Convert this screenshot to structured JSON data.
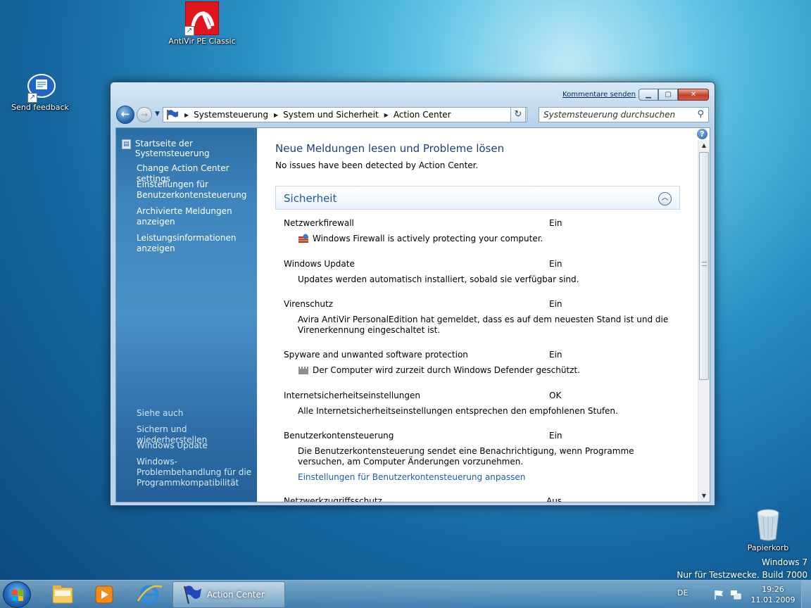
{
  "desktop": {
    "icons": [
      {
        "label": "AntiVir PE Classic",
        "icon": "avira-umbrella-icon"
      },
      {
        "label": "Send feedback",
        "icon": "speech-bubble-icon"
      },
      {
        "label": "Papierkorb",
        "icon": "recycle-bin-icon"
      }
    ],
    "watermark": {
      "line1": "Windows 7",
      "line2": "Nur für Testzwecke. Build 7000"
    }
  },
  "window": {
    "kommentare": "Kommentare senden",
    "controls": {
      "minimize": "minimize-icon",
      "maximize": "maximize-icon",
      "close": "close-icon"
    },
    "breadcrumb": [
      "Systemsteuerung",
      "System und Sicherheit",
      "Action Center"
    ],
    "search_placeholder": "Systemsteuerung durchsuchen",
    "left_pane": {
      "home": "Startseite der Systemsteuerung",
      "links": [
        "Change Action Center settings",
        "Einstellungen für Benutzerkontensteuerung",
        "Archivierte Meldungen anzeigen",
        "Leistungsinformationen anzeigen"
      ],
      "see_also_heading": "Siehe auch",
      "see_also": [
        "Sichern und wiederherstellen",
        "Windows Update",
        "Windows-Problembehandlung für die Programmkompatibilität"
      ]
    },
    "main": {
      "title": "Neue Meldungen lesen und Probleme lösen",
      "subtitle": "No issues have been detected by Action Center.",
      "section_title": "Sicherheit",
      "rows": [
        {
          "name": "Netzwerkfirewall",
          "status": "Ein",
          "desc": "Windows Firewall is actively protecting your computer."
        },
        {
          "name": "Windows Update",
          "status": "Ein",
          "desc": "Updates werden automatisch installiert, sobald sie verfügbar sind."
        },
        {
          "name": "Virenschutz",
          "status": "Ein",
          "desc": "Avira AntiVir PersonalEdition hat gemeldet, dass es auf dem neuesten Stand ist und die Virenerkennung eingeschaltet ist."
        },
        {
          "name": "Spyware and unwanted software protection",
          "status": "Ein",
          "desc": "Der Computer wird zurzeit durch Windows Defender geschützt."
        },
        {
          "name": "Internetsicherheitseinstellungen",
          "status": "OK",
          "desc": "Alle Internetsicherheitseinstellungen entsprechen den empfohlenen Stufen."
        },
        {
          "name": "Benutzerkontensteuerung",
          "status": "Ein",
          "desc": "Die Benutzerkontensteuerung sendet eine Benachrichtigung, wenn Programme versuchen, am Computer Änderungen vorzunehmen.",
          "link": "Einstellungen für Benutzerkontensteuerung anpassen"
        },
        {
          "name": "Netzwerkzugriffsschutz",
          "status": "Aus"
        }
      ]
    }
  },
  "taskbar": {
    "pinned": [
      "windows-explorer-icon",
      "media-player-icon",
      "internet-explorer-icon"
    ],
    "active_app": "Action Center",
    "language": "DE",
    "time": "19:26",
    "date": "11.01.2009"
  }
}
